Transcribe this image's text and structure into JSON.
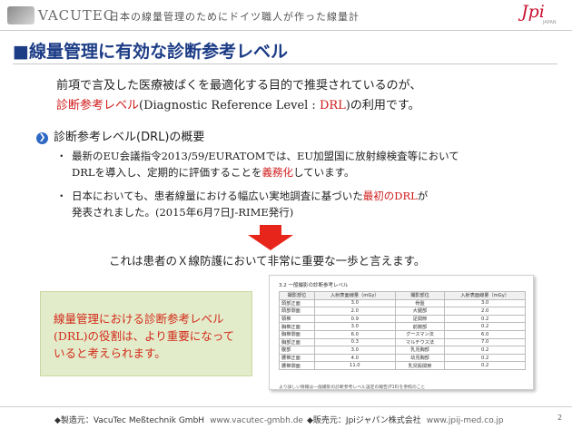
{
  "header": {
    "logo": "VACUTEC",
    "tagline": "日本の線量管理のためにドイツ職人が作った線量計",
    "partner_logo": "Jpi",
    "partner_logo_sub": "JAPAN"
  },
  "slide": {
    "title": "■線量管理に有効な診断参考レベル",
    "intro_line1": "前項で言及した医療被ばくを最適化する目的で推奨されているのが、",
    "intro_line2_red": "診断参考レベル",
    "intro_line2_mid": "(Diagnostic Reference Level : ",
    "intro_line2_drl": "DRL",
    "intro_line2_end": ")の利用です。",
    "section_icon": "chevron-right",
    "section_heading": "診断参考レベル(DRL)の概要",
    "bullet1_line1": "最新のEU会議指令2013/59/EURATOMでは、EU加盟国に放射線検査等において",
    "bullet1_line2_pre": "DRLを導入し、定期的に評価することを",
    "bullet1_line2_red": "義務化",
    "bullet1_line2_end": "しています。",
    "bullet2_line1_pre": "日本においても、患者線量における幅広い実地調査に基づいた",
    "bullet2_line1_red": "最初のDRL",
    "bullet2_line1_end": "が",
    "bullet2_line2": "発表されました。(2015年6月7日J-RIME発行)",
    "bullet_marker": "・",
    "conclusion": "これは患者のＸ線防護において非常に重要な一歩と言えます。",
    "highlight_box": "線量管理における診断参考レベル(DRL)の役割は、より重要になっていると考えられます。"
  },
  "drl_document": {
    "title": "3.2 一般撮影の診断参考レベル",
    "headers": [
      "撮影部位",
      "入射表面線量（mGy）",
      "撮影部位",
      "入射表面線量（mGy）"
    ],
    "rows": [
      [
        "頭部正面",
        "3.0",
        "骨盤",
        "3.0"
      ],
      [
        "頭部側面",
        "2.0",
        "大腿部",
        "2.0"
      ],
      [
        "頸椎",
        "0.9",
        "足関節",
        "0.2"
      ],
      [
        "胸椎正面",
        "3.0",
        "前腕部",
        "0.2"
      ],
      [
        "胸椎側面",
        "6.0",
        "グースマン法",
        "6.0"
      ],
      [
        "胸部正面",
        "0.3",
        "マルチウス法",
        "7.0"
      ],
      [
        "腹部",
        "3.0",
        "乳児胸部",
        "0.2"
      ],
      [
        "腰椎正面",
        "4.0",
        "幼児胸部",
        "0.2"
      ],
      [
        "腰椎側面",
        "11.0",
        "乳児股関節",
        "0.2"
      ]
    ],
    "note": "より詳しい情報は一般撮影の診断参考レベル設定の報告(P16)を参照のこと"
  },
  "footer": {
    "manufacturer": "◆製造元：VacuTec Meßtechnik GmbH",
    "manufacturer_url": "www.vacutec-gmbh.de",
    "seller": "◆販売元：Jpiジャパン株式会社",
    "seller_url": "www.jpij-med.co.jp",
    "page_number": "2"
  },
  "colors": {
    "title_blue": "#1c3c86",
    "accent_red": "#d01a1a",
    "arrow_red": "#e8251a",
    "box_green": "#e3ecca"
  }
}
